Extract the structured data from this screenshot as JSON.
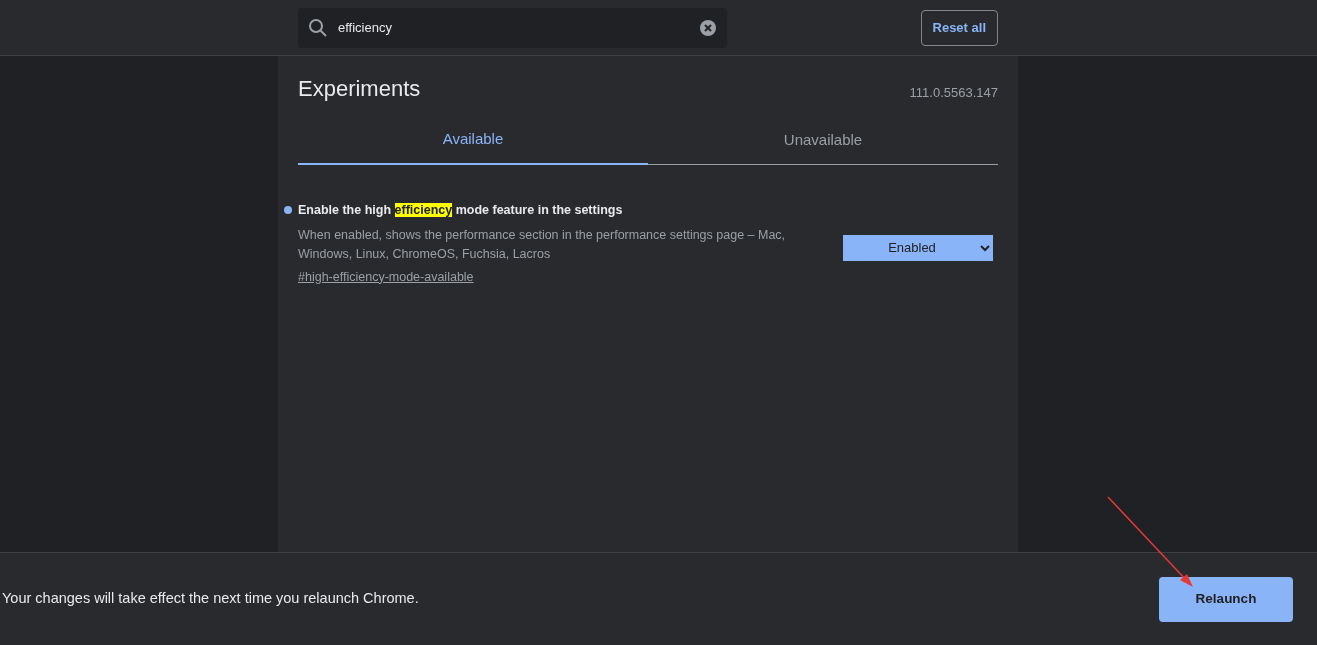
{
  "search": {
    "value": "efficiency"
  },
  "reset_button": "Reset all",
  "title": "Experiments",
  "version": "111.0.5563.147",
  "tabs": [
    {
      "label": "Available",
      "selected": true
    },
    {
      "label": "Unavailable",
      "selected": false
    }
  ],
  "experiments": [
    {
      "modified": true,
      "title_before_match": "Enable the high ",
      "title_match": "efficiency",
      "title_after_match": " mode feature in the settings",
      "description": "When enabled, shows the performance section in the performance settings page – Mac, Windows, Linux, ChromeOS, Fuchsia, Lacros",
      "link": "#high-efficiency-mode-available",
      "value": "Enabled"
    }
  ],
  "footer": {
    "message": "Your changes will take effect the next time you relaunch Chrome.",
    "button": "Relaunch"
  }
}
